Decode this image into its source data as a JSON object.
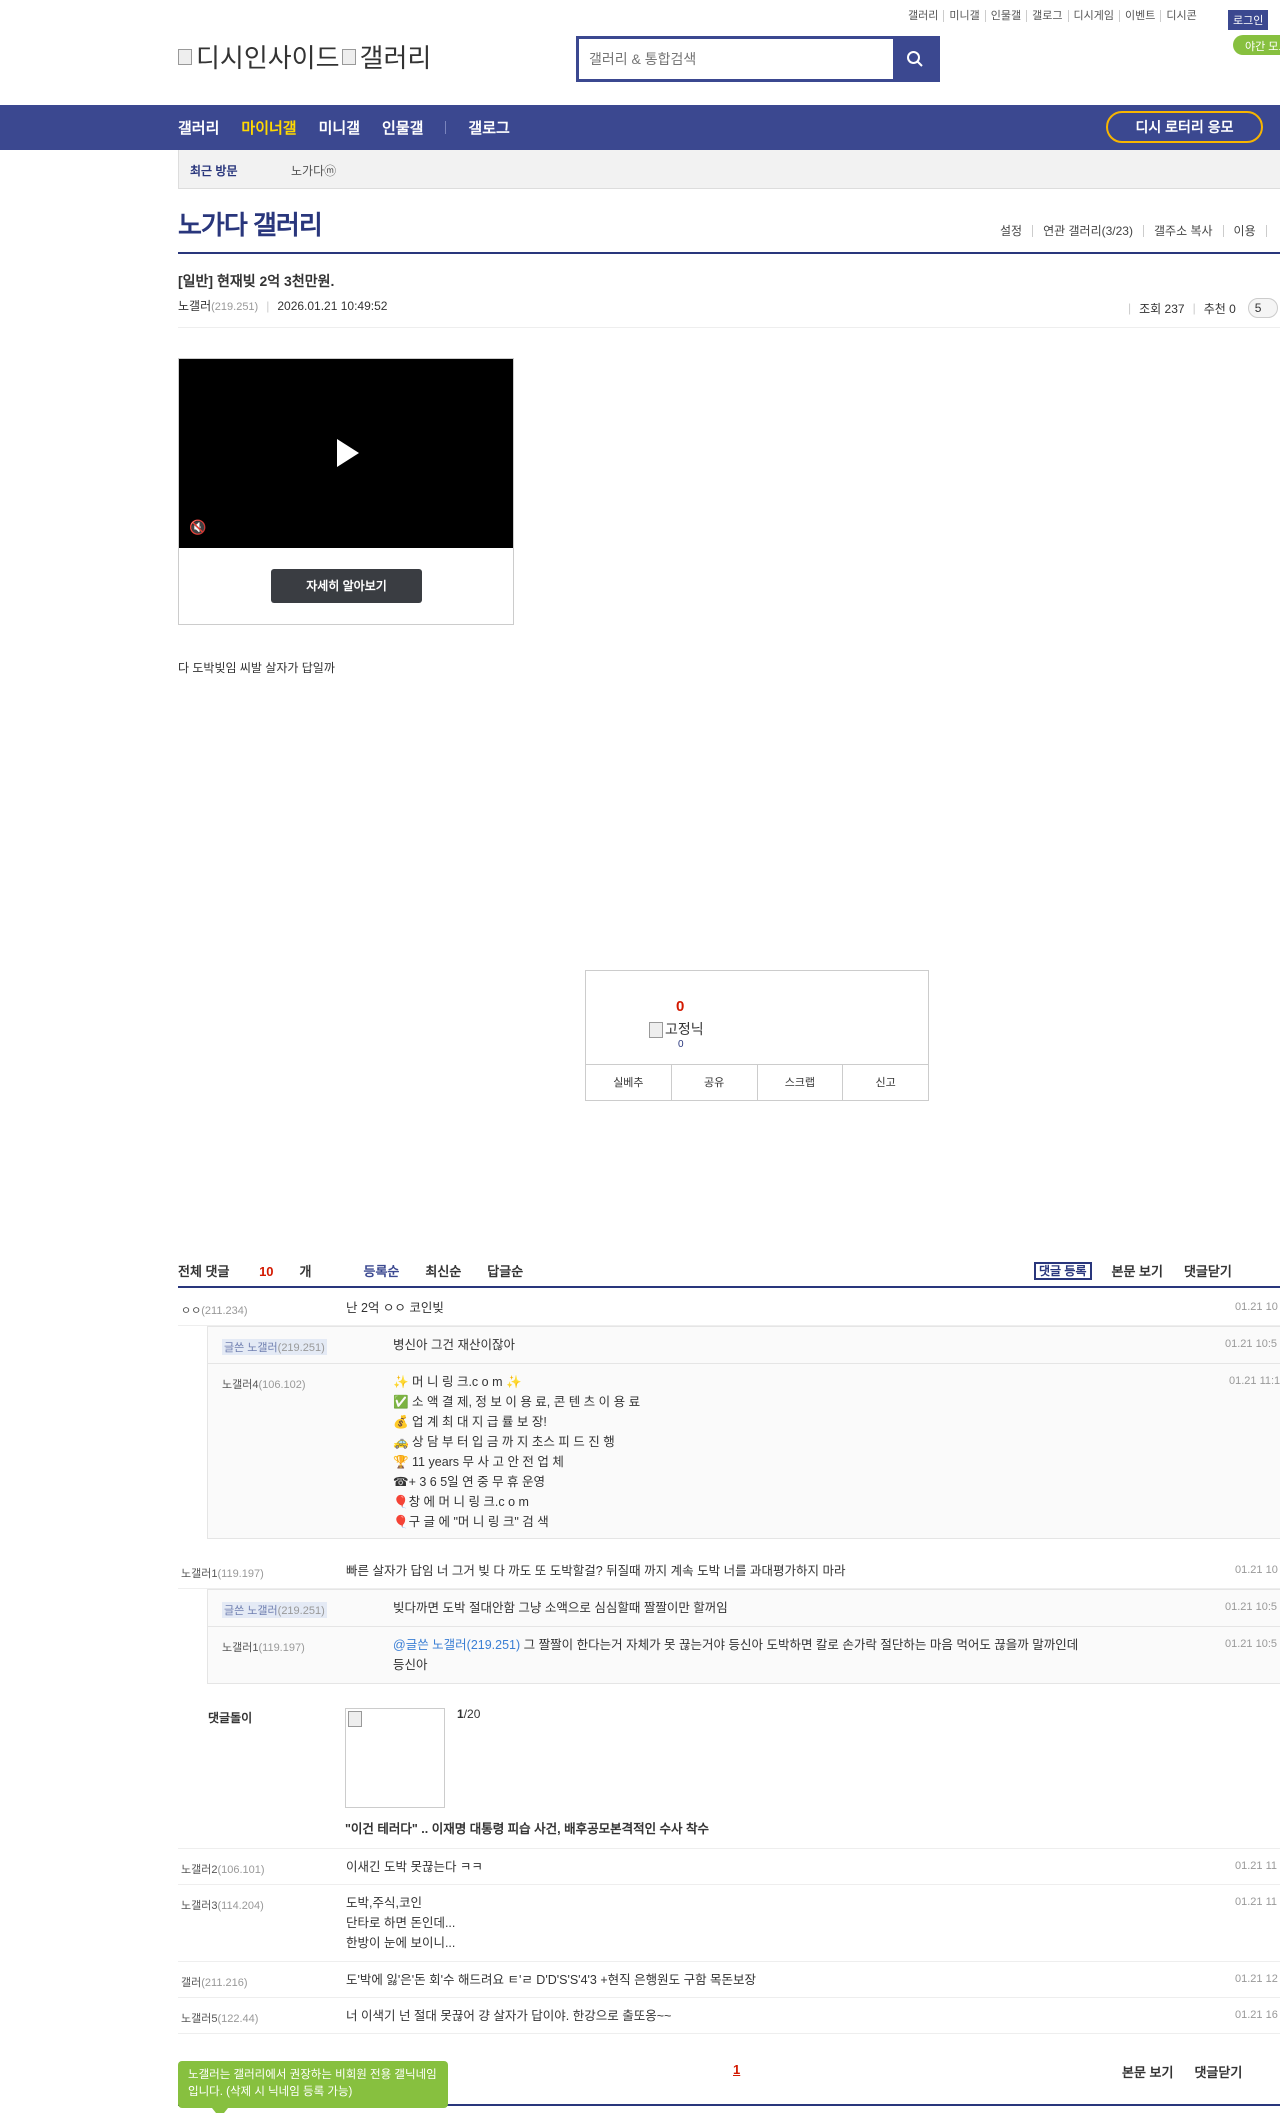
{
  "top_util": [
    "갤러리",
    "미니갤",
    "인물갤",
    "갤로그",
    "디시게임",
    "이벤트",
    "디시콘"
  ],
  "login": "로그인",
  "night_mode": "야간 모드",
  "logo_alt": "디시인사이드",
  "logo_alt2": "갤러리",
  "search": {
    "placeholder": "갤러리 & 통합검색"
  },
  "gnb": {
    "items": [
      "갤러리",
      "마이너갤",
      "미니갤",
      "인물갤"
    ],
    "extra": "갤로그",
    "lotto": "디시 로터리 응모"
  },
  "recent": {
    "label": "최근 방문",
    "item": "노가다ⓜ"
  },
  "gallery": {
    "title": "노가다 갤러리",
    "links": [
      "설정",
      "연관 갤러리(3/23)",
      "갤주소 복사",
      "이용"
    ]
  },
  "post": {
    "title": "[일반] 현재빚 2억 3천만원.",
    "nick": "노갤러",
    "ip": "(219.251)",
    "date": "2026.01.21 10:49:52",
    "views": "조회 237",
    "recommend": "추천 0",
    "comments_badge": "5",
    "body": "다 도박빚임 씨발 살자가 답일까"
  },
  "video": {
    "button": "자세히 알아보기",
    "mute_icon": "🔇"
  },
  "rec_box": {
    "count": "0",
    "fixed_nick_alt": "고정닉",
    "sub_count": "0",
    "buttons": [
      "실베추",
      "공유",
      "스크랩",
      "신고"
    ]
  },
  "comment_head": {
    "total_prefix": "전체 댓글 ",
    "total_count": "10",
    "total_suffix": "개",
    "sorts": [
      "등록순",
      "최신순",
      "답글순"
    ],
    "register": "댓글 등록",
    "view_body": "본문 보기",
    "close": "댓글닫기"
  },
  "comments": [
    {
      "nick": "ㅇㅇ",
      "ip": "(211.234)",
      "text": "난 2억 ㅇㅇ 코인빚",
      "date": "01.21 10"
    },
    {
      "nick": "글쓴 노갤러",
      "ip": "(219.251)",
      "text": "병신아 그건 재산이잖아",
      "date": "01.21 10:5"
    },
    {
      "nick": "노갤러4",
      "ip": "(106.102)",
      "lines": [
        "✨ 머 니 링 크.c o m ✨",
        "✅ 소 액 결 제, 정 보 이 용 료, 콘 텐 츠 이 용 료",
        "💰 업 계 최 대 지 급 률 보 장!",
        "🚕 상 담 부 터 입 금 까 지 초스 피 드 진 행",
        "🏆 11 years 무 사 고 안 전 업 체",
        "☎+ 3 6 5일 연 중 무 휴 운영",
        "🎈창 에 머 니 링 크.c o m",
        "🎈구 글 에 \"머 니 링 크\" 검 색"
      ],
      "date": "01.21 11:1"
    },
    {
      "nick": "노갤러1",
      "ip": "(119.197)",
      "text": "빠른 살자가 답임 너 그거 빚 다 까도 또 도박할걸? 뒤질때 까지 계속 도박 너를 과대평가하지 마라",
      "date": "01.21 10"
    },
    {
      "nick": "글쓴 노갤러",
      "ip": "(219.251)",
      "text": "빚다까면 도박 절대안함 그냥 소액으로 심심할때 짤짤이만 할꺼임",
      "date": "01.21 10:5"
    },
    {
      "nick": "노갤러1",
      "ip": "(119.197)",
      "mention": "@글쓴 노갤러(219.251)",
      "text": " 그 짤짤이 한다는거 자체가 못 끊는거야 등신아 도박하면 칼로 손가락 절단하는 마음 먹어도 끊을까 말까인데",
      "text2": "등신아",
      "date": "01.21 10:5"
    },
    {
      "nick": "노갤러2",
      "ip": "(106.101)",
      "text": "이새긴 도박 못끊는다 ㅋㅋ",
      "date": "01.21 11"
    },
    {
      "nick": "노갤러3",
      "ip": "(114.204)",
      "lines": [
        "도박,주식,코인",
        "단타로 하면 돈인데...",
        "한방이 눈에 보이니..."
      ],
      "date": "01.21 11"
    },
    {
      "nick": "갤러",
      "ip": "(211.216)",
      "text": "도'박에 잃'은'돈 회'수 해드려요 ㅌ'ㄹ D'D'S'S'4'3 +현직 은행원도 구함 목돈보장",
      "date": "01.21 12"
    },
    {
      "nick": "노갤러5",
      "ip": "(122.44)",
      "text": "너 이색기 넌 절대 못끊어 걍 살자가 답이야. 한강으로 출또옹~~",
      "date": "01.21 16"
    }
  ],
  "dolli": {
    "label": "댓글돌이",
    "count_current": "1",
    "count_total": "/20",
    "title": "\"이건 테러다\" .. 이재명 대통령 피습 사건, 배후공모본격적인 수사 착수"
  },
  "pagination": {
    "current": "1"
  },
  "toast": "노갤러는 갤러리에서 권장하는 비회원 전용 갤닉네임입니다. (삭제 시 닉네임 등록 가능)",
  "colors": {
    "brand": "#3b4890",
    "accent": "#ffd800",
    "alert": "#d31900",
    "green": "#87c03f"
  }
}
